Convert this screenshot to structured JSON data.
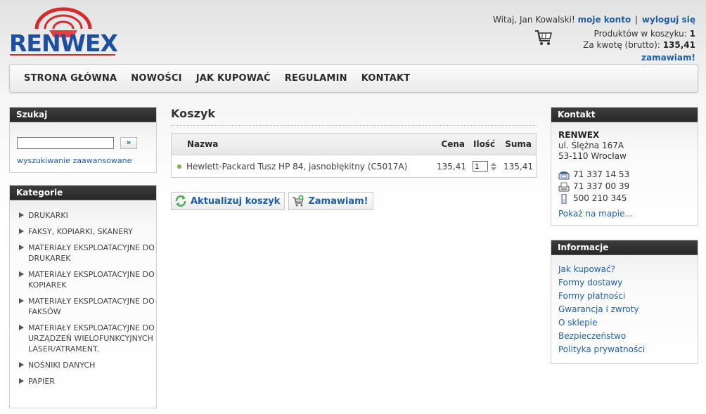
{
  "brand": {
    "logo_text": "RENWEX"
  },
  "user": {
    "greeting": "Witaj, Jan Kowalski!",
    "account_link": "moje konto",
    "separator": "|",
    "logout_link": "wyloguj się"
  },
  "cart_summary": {
    "products_label": "Produktów w koszyku:",
    "products_count": "1",
    "amount_label": "Za kwotę (brutto):",
    "amount_value": "135,41",
    "order_link": "zamawiam!"
  },
  "nav": {
    "items": [
      {
        "label": "STRONA GŁÓWNA"
      },
      {
        "label": "NOWOŚCI"
      },
      {
        "label": "JAK KUPOWAĆ"
      },
      {
        "label": "REGULAMIN"
      },
      {
        "label": "KONTAKT"
      }
    ]
  },
  "search": {
    "title": "Szukaj",
    "input_value": "",
    "button_label": "»",
    "advanced_link": "wyszukiwanie zaawansowane"
  },
  "categories": {
    "title": "Kategorie",
    "items": [
      {
        "label": "DRUKARKI"
      },
      {
        "label": "FAKSY, KOPIARKI, SKANERY"
      },
      {
        "label": "MATERIAŁY EKSPLOATACYJNE DO DRUKAREK"
      },
      {
        "label": "MATERIAŁY EKSPLOATACYJNE DO KOPIAREK"
      },
      {
        "label": "MATERIAŁY EKSPLOATACYJNE DO FAKSÓW"
      },
      {
        "label": "MATERIAŁY EKSPLOATACYJNE DO URZĄDZEŃ WIELOFUNKCYJNYCH LASER/ATRAMENT."
      },
      {
        "label": "NOŚNIKI DANYCH"
      },
      {
        "label": "PAPIER"
      }
    ]
  },
  "main": {
    "title": "Koszyk",
    "table": {
      "headers": {
        "name": "Nazwa",
        "price": "Cena",
        "qty": "Ilość",
        "sum": "Suma"
      },
      "rows": [
        {
          "name": "Hewlett-Packard Tusz HP 84, jasnobłękitny (C5017A)",
          "price": "135,41",
          "qty": "1",
          "sum": "135,41"
        }
      ]
    },
    "update_button": "Aktualizuj koszyk",
    "order_button": "Zamawiam!"
  },
  "contact": {
    "title": "Kontakt",
    "company": "RENWEX",
    "street": "ul. Ślężna 167A",
    "city": "53-110 Wrocław",
    "phone": "71 337 14 53",
    "fax": "71 337 00 39",
    "mobile": "500 210 345",
    "map_link": "Pokaż na mapie..."
  },
  "info": {
    "title": "Informacje",
    "links": [
      {
        "label": "Jak kupować?"
      },
      {
        "label": "Formy dostawy"
      },
      {
        "label": "Formy płatności"
      },
      {
        "label": "Gwarancja i zwroty"
      },
      {
        "label": "O sklepie"
      },
      {
        "label": "Bezpieczeństwo"
      },
      {
        "label": "Polityka prywatności"
      }
    ]
  },
  "colors": {
    "link": "#1f5fa8",
    "brand_blue": "#1e4f9c",
    "brand_red": "#d42a2a",
    "header_dark": "#2d2d2d"
  }
}
